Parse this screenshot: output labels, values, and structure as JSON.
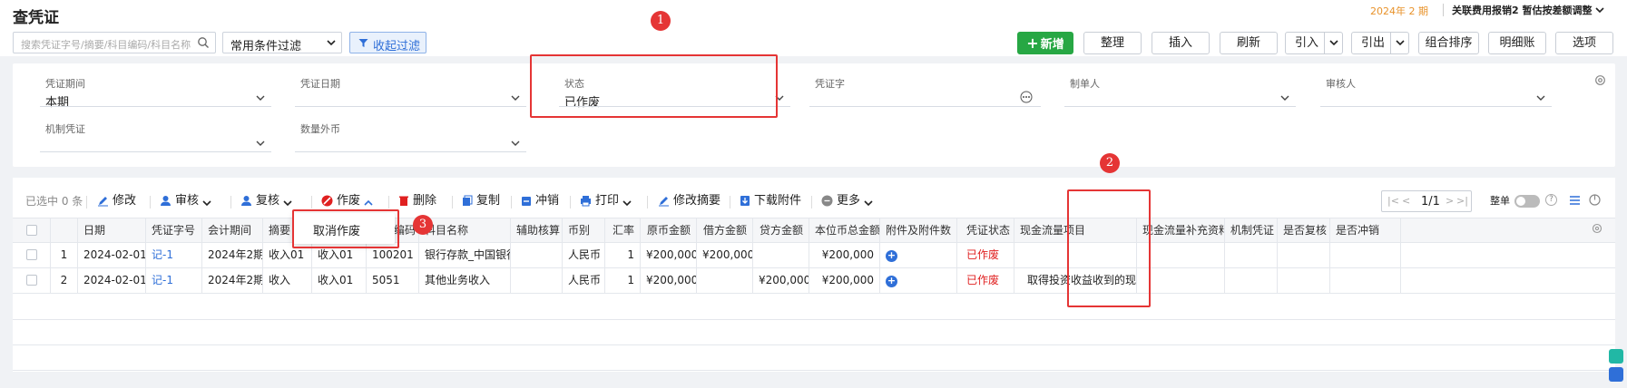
{
  "header": {
    "title": "查凭证",
    "period": "2024年 2 期",
    "org": "关联费用报销2 暂估按差额调整"
  },
  "topbar": {
    "search_placeholder": "搜索凭证字号/摘要/科目编码/科目名称",
    "filter_scheme": "常用条件过滤",
    "collapse_filter": "收起过滤",
    "buttons": {
      "add": "新增",
      "organize": "整理",
      "insert": "插入",
      "refresh": "刷新",
      "import": "引入",
      "export": "引出",
      "combo_sort": "组合排序",
      "detail_ledger": "明细账",
      "options": "选项"
    }
  },
  "filters": {
    "period": {
      "label": "凭证期间",
      "value": "本期"
    },
    "date": {
      "label": "凭证日期",
      "value": ""
    },
    "status": {
      "label": "状态",
      "value": "已作废"
    },
    "voucher_word": {
      "label": "凭证字",
      "value": ""
    },
    "preparer": {
      "label": "制单人",
      "value": ""
    },
    "reviewer": {
      "label": "审核人",
      "value": ""
    },
    "machine": {
      "label": "机制凭证",
      "value": ""
    },
    "qty_fx": {
      "label": "数量外币",
      "value": ""
    }
  },
  "toolbar": {
    "selected": "已选中 0 条",
    "edit": "修改",
    "audit": "审核",
    "recheck": "复核",
    "void": "作废",
    "delete": "删除",
    "copy": "复制",
    "reverse": "冲销",
    "print": "打印",
    "edit_summary": "修改摘要",
    "download_attach": "下载附件",
    "more": "更多",
    "pager": "1/1",
    "whole_label": "整单"
  },
  "void_menu": {
    "cancel_void": "取消作废"
  },
  "table": {
    "columns": [
      "日期",
      "凭证字号",
      "会计期间",
      "摘要",
      "摘要",
      "科目编码",
      "科目名称",
      "辅助核算",
      "币别",
      "汇率",
      "原币金额",
      "借方金额",
      "贷方金额",
      "本位币总金额",
      "附件及附件数",
      "凭证状态",
      "现金流量项目",
      "现金流量补充资料",
      "机制凭证",
      "是否复核",
      "是否冲销"
    ],
    "rows": [
      {
        "no": "1",
        "date": "2024-02-01",
        "voucher": "记-1",
        "period": "2024年2期",
        "sum1": "收入01",
        "sum2": "收入01",
        "code": "100201",
        "account": "银行存款_中国银行",
        "aux": "",
        "currency": "人民币",
        "rate": "1",
        "orig": "¥200,000",
        "debit": "¥200,000",
        "credit": "",
        "total": "¥200,000",
        "status": "已作废",
        "cashflow": ""
      },
      {
        "no": "2",
        "date": "2024-02-01",
        "voucher": "记-1",
        "period": "2024年2期",
        "sum1": "收入",
        "sum2": "收入01",
        "code": "5051",
        "account": "其他业务收入",
        "aux": "",
        "currency": "人民币",
        "rate": "1",
        "orig": "¥200,000",
        "debit": "",
        "credit": "¥200,000",
        "total": "¥200,000",
        "status": "已作废",
        "cashflow": "取得投资收益收到的现金"
      }
    ]
  },
  "annotations": {
    "one": "1",
    "two": "2",
    "three": "3"
  },
  "colors": {
    "accent": "#2f6fd8",
    "primary_green": "#27a744",
    "highlight_red": "#e53535",
    "void_red": "#e02020",
    "period_orange": "#e8922a"
  }
}
